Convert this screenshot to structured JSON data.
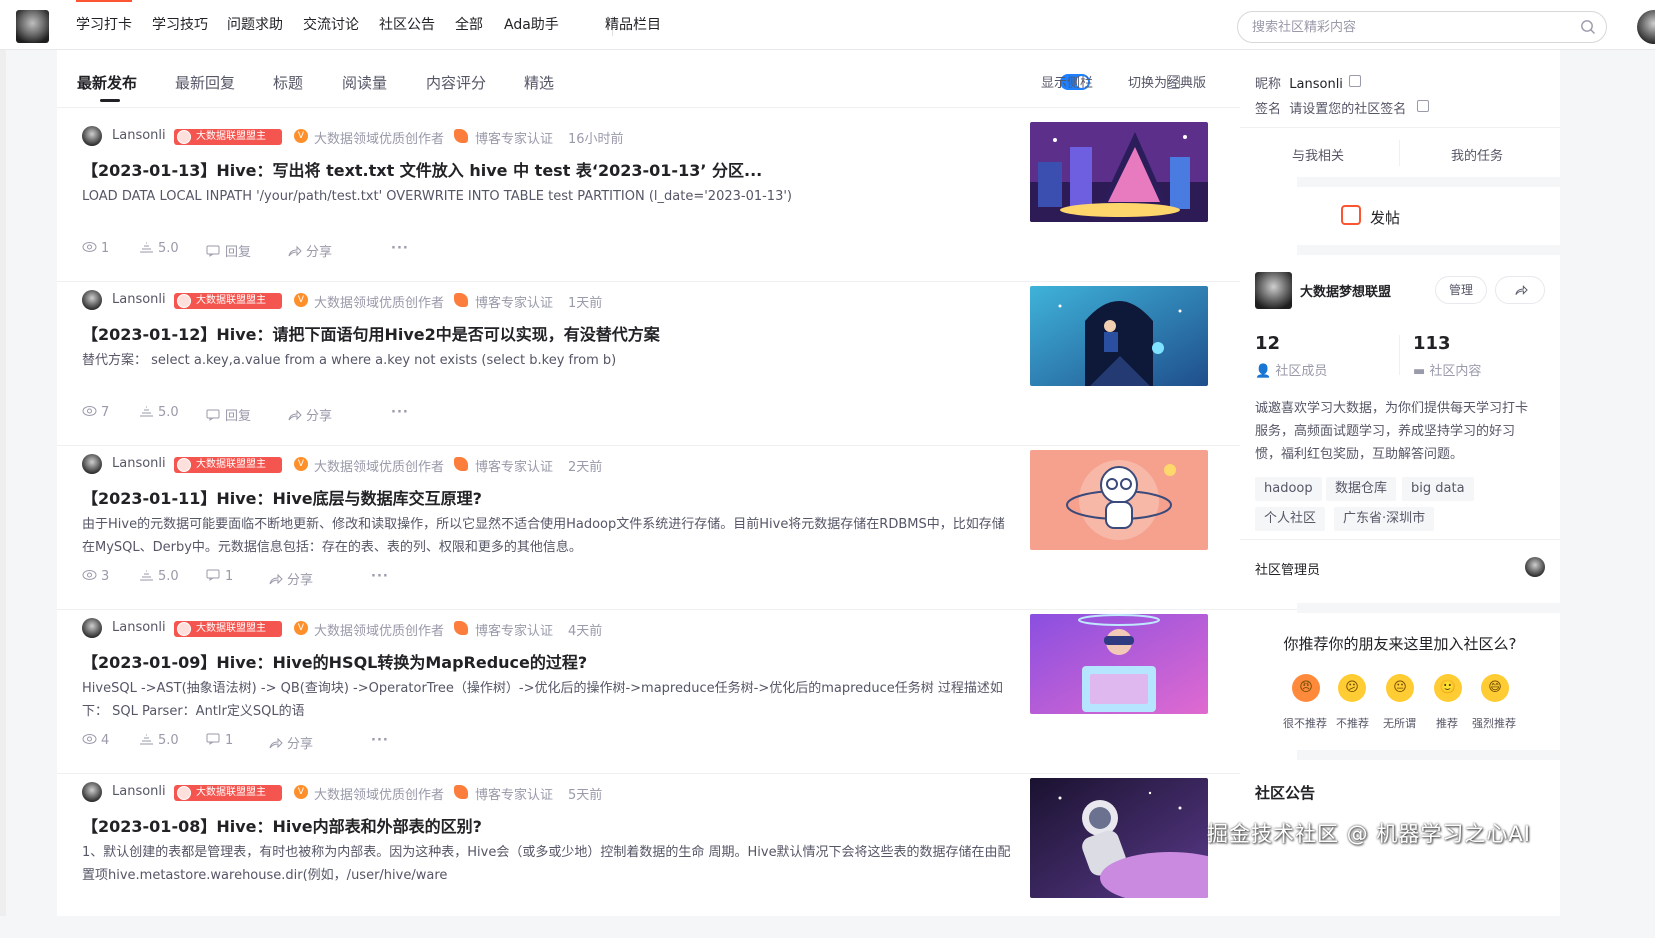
{
  "top_nav": {
    "items": [
      "学习打卡",
      "学习技巧",
      "问题求助",
      "交流讨论",
      "社区公告",
      "全部",
      "Ada助手"
    ],
    "special": "精品栏目",
    "search_placeholder": "搜索社区精彩内容"
  },
  "sort_tabs": [
    "最新发布",
    "最新回复",
    "标题",
    "阅读量",
    "内容评分",
    "精选"
  ],
  "toolbar": {
    "show_sidebar": "显示侧栏",
    "switch_classic": "切换为经典版"
  },
  "posts": [
    {
      "author": "Lansonli",
      "badge": "大数据联盟盟主",
      "creator": "大数据领域优质创作者",
      "cert": "博客专家认证",
      "time": "16小时前",
      "title": "【2023-01-13】Hive：写出将 text.txt 文件放入 hive 中 test 表‘2023-01-13’ 分区...",
      "desc": "LOAD DATA LOCAL INPATH '/your/path/test.txt' OVERWRITE INTO TABLE test PARTITION (l_date='2023-01-13')",
      "views": "1",
      "score": "5.0",
      "reply": "回复",
      "share": "分享"
    },
    {
      "author": "Lansonli",
      "badge": "大数据联盟盟主",
      "creator": "大数据领域优质创作者",
      "cert": "博客专家认证",
      "time": "1天前",
      "title": "【2023-01-12】Hive：请把下面语句用Hive2中是否可以实现，有没替代方案",
      "desc": "替代方案： select a.key,a.value from a where a.key not exists (select b.key from b)",
      "views": "7",
      "score": "5.0",
      "reply": "回复",
      "share": "分享"
    },
    {
      "author": "Lansonli",
      "badge": "大数据联盟盟主",
      "creator": "大数据领域优质创作者",
      "cert": "博客专家认证",
      "time": "2天前",
      "title": "【2023-01-11】Hive：Hive底层与数据库交互原理?",
      "desc": "由于Hive的元数据可能要面临不断地更新、修改和读取操作，所以它显然不适合使用Hadoop文件系统进行存储。目前Hive将元数据存储在RDBMS中，比如存储在MySQL、Derby中。元数据信息包括：存在的表、表的列、权限和更多的其他信息。",
      "views": "3",
      "score": "5.0",
      "reply": "1",
      "share": "分享"
    },
    {
      "author": "Lansonli",
      "badge": "大数据联盟盟主",
      "creator": "大数据领域优质创作者",
      "cert": "博客专家认证",
      "time": "4天前",
      "title": "【2023-01-09】Hive：Hive的HSQL转换为MapReduce的过程?",
      "desc": "HiveSQL ->AST(抽象语法树) -> QB(查询块) ->OperatorTree（操作树）->优化后的操作树->mapreduce任务树->优化后的mapreduce任务树 过程描述如下： SQL Parser：Antlr定义SQL的语",
      "views": "4",
      "score": "5.0",
      "reply": "1",
      "share": "分享"
    },
    {
      "author": "Lansonli",
      "badge": "大数据联盟盟主",
      "creator": "大数据领域优质创作者",
      "cert": "博客专家认证",
      "time": "5天前",
      "title": "【2023-01-08】Hive：Hive内部表和外部表的区别?",
      "desc": "1、默认创建的表都是管理表，有时也被称为内部表。因为这种表，Hive会（或多或少地）控制着数据的生命 周期。Hive默认情况下会将这些表的数据存储在由配置项hive.metastore.warehouse.dir(例如，/user/hive/ware",
      "views": "",
      "score": "",
      "reply": "",
      "share": ""
    }
  ],
  "sidebar": {
    "nickname_label": "昵称",
    "nickname": "Lansonli",
    "signature_label": "签名",
    "signature": "请设置您的社区签名",
    "related": "与我相关",
    "tasks": "我的任务",
    "post_btn": "发帖",
    "community": {
      "name": "大数据梦想联盟",
      "manage": "管理",
      "members": "12",
      "members_label": "社区成员",
      "contents": "113",
      "contents_label": "社区内容",
      "desc": "诚邀喜欢学习大数据，为你们提供每天学习打卡服务，高频面试题学习，养成坚持学习的好习惯，福利红包奖励，互助解答问题。",
      "tags": [
        "hadoop",
        "数据仓库",
        "big data",
        "个人社区",
        "广东省·深圳市"
      ],
      "admin_label": "社区管理员"
    },
    "recommend": {
      "question": "你推荐你的朋友来这里加入社区么?",
      "options": [
        "很不推荐",
        "不推荐",
        "无所谓",
        "推荐",
        "强烈推荐"
      ]
    },
    "notice_title": "社区公告"
  },
  "watermark": "掘金技术社区 @ 机器学习之心AI"
}
